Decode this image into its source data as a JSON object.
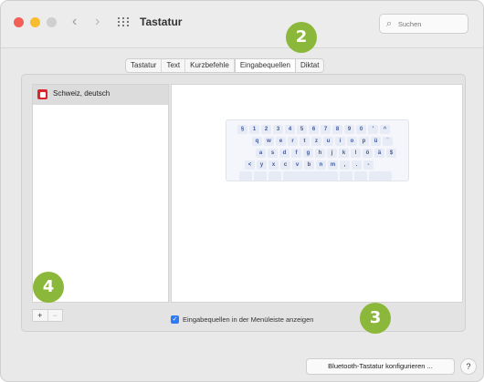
{
  "window": {
    "title": "Tastatur",
    "nav": {
      "back": "‹",
      "forward": "›"
    },
    "search": {
      "placeholder": "Suchen"
    }
  },
  "tabs": [
    {
      "label": "Tastatur"
    },
    {
      "label": "Text"
    },
    {
      "label": "Kurzbefehle"
    },
    {
      "label": "Eingabequellen",
      "active": true
    },
    {
      "label": "Diktat"
    }
  ],
  "sidebar": {
    "items": [
      {
        "label": "Schweiz, deutsch",
        "icon": "swiss-flag-icon",
        "selected": true
      }
    ],
    "add_label": "+",
    "remove_label": "−"
  },
  "keyboard": {
    "row1": [
      "§",
      "1",
      "2",
      "3",
      "4",
      "5",
      "6",
      "7",
      "8",
      "9",
      "0",
      "'",
      "^"
    ],
    "row2": [
      "q",
      "w",
      "e",
      "r",
      "t",
      "z",
      "u",
      "i",
      "o",
      "p",
      "ü",
      "¨"
    ],
    "row3": [
      "a",
      "s",
      "d",
      "f",
      "g",
      "h",
      "j",
      "k",
      "l",
      "ö",
      "ä",
      "$"
    ],
    "row4": [
      "<",
      "y",
      "x",
      "c",
      "v",
      "b",
      "n",
      "m",
      ",",
      ".",
      "-"
    ]
  },
  "checkbox": {
    "label": "Eingabequellen in der Menüleiste anzeigen",
    "checked": true
  },
  "footer": {
    "bluetooth_button": "Bluetooth-Tastatur konfigurieren ...",
    "help_label": "?"
  },
  "callouts": {
    "c2": "2",
    "c3": "3",
    "c4": "4"
  },
  "colors": {
    "accent": "#2f7bf5",
    "callout": "#8bb83a",
    "close": "#f25f57",
    "minimize": "#f8bc2f"
  }
}
